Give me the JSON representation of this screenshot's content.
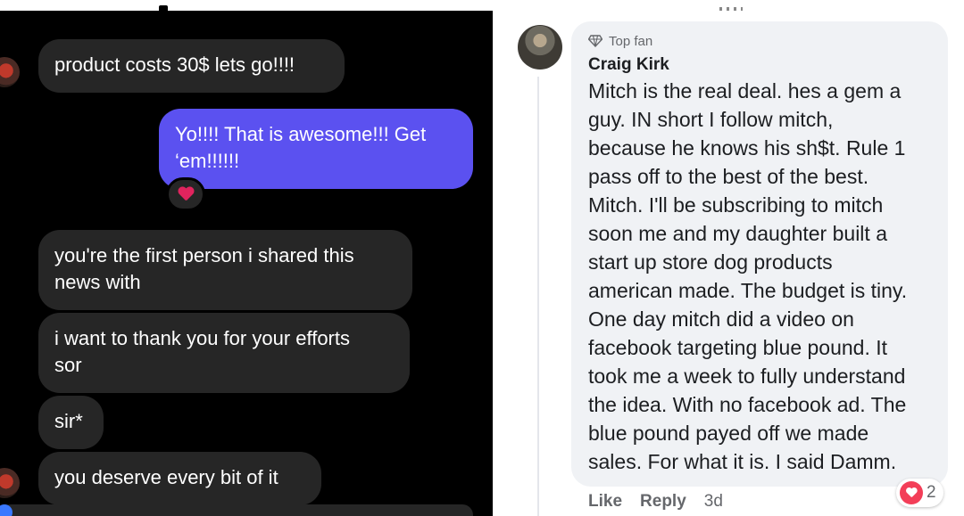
{
  "chat": {
    "messages": [
      {
        "id": "m1",
        "direction": "incoming",
        "text": "product costs 30$ lets go!!!!"
      },
      {
        "id": "m2",
        "direction": "outgoing",
        "lines": [
          "Yo!!!! That is awesome!!! Get",
          "‘em!!!!!!"
        ]
      },
      {
        "id": "m3",
        "direction": "incoming",
        "lines": [
          "you're the first person i shared this",
          "news with"
        ]
      },
      {
        "id": "m4",
        "direction": "incoming",
        "lines": [
          "i want to thank you for your efforts",
          "sor"
        ]
      },
      {
        "id": "m5",
        "direction": "incoming",
        "text": "sir*"
      },
      {
        "id": "m6",
        "direction": "incoming",
        "text": "you deserve every bit of it"
      }
    ],
    "reaction_icon": "heart-icon",
    "colors": {
      "outgoing_bubble": "#5b51f0",
      "incoming_bubble": "#262626",
      "heart": "#e0245e"
    }
  },
  "comment": {
    "badge": "Top fan",
    "badge_icon": "diamond-icon",
    "author": "Craig Kirk",
    "body_lines": [
      "Mitch is the real deal. hes a gem a",
      "guy. IN short I follow mitch,",
      "because he knows his sh$t. Rule 1",
      "pass off to the best of the best.",
      "Mitch. I'll be subscribing to mitch",
      "soon me and my daughter built a",
      "start up store dog products",
      "american made. The budget is tiny.",
      "One day mitch did a video on",
      "facebook targeting blue pound. It",
      "took me a week to fully understand",
      "the idea. With no facebook ad. The",
      "blue pound payed off we made",
      "sales. For what it is. I said Damm."
    ],
    "actions": {
      "like": "Like",
      "reply": "Reply",
      "time": "3d"
    },
    "reaction_icon": "love-icon",
    "reaction_count": "2",
    "colors": {
      "box": "#f0f2f5",
      "love": "#f33e58",
      "meta_text": "#65676b"
    }
  }
}
